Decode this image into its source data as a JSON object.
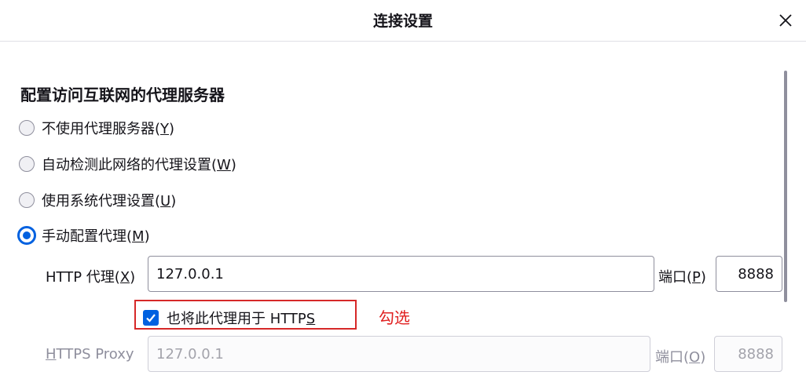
{
  "dialog": {
    "title": "连接设置"
  },
  "section": {
    "heading": "配置访问互联网的代理服务器"
  },
  "radios": [
    {
      "label": "不使用代理服务器(",
      "key": "Y",
      "suffix": ")",
      "checked": false
    },
    {
      "label": "自动检测此网络的代理设置(",
      "key": "W",
      "suffix": ")",
      "checked": false
    },
    {
      "label": "使用系统代理设置(",
      "key": "U",
      "suffix": ")",
      "checked": false
    },
    {
      "label": "手动配置代理(",
      "key": "M",
      "suffix": ")",
      "checked": true
    }
  ],
  "http": {
    "label_prefix": "HTTP 代理(",
    "label_key": "X",
    "label_suffix": ")",
    "value": "127.0.0.1",
    "port_prefix": "端口(",
    "port_key": "P",
    "port_suffix": ")",
    "port": "8888"
  },
  "https_checkbox": {
    "label_prefix": "也将此代理用于 HTTP",
    "label_key": "S",
    "checked": true
  },
  "annotation": "勾选",
  "https": {
    "label_key": "H",
    "label_rest": "TTPS Proxy",
    "value": "127.0.0.1",
    "port_prefix": "端口(",
    "port_key": "O",
    "port_suffix": ")",
    "port": "8888"
  },
  "colors": {
    "accent": "#0061e0",
    "annotation": "#e02020"
  },
  "icons": {
    "close": "close-icon",
    "check": "checkmark-icon"
  }
}
